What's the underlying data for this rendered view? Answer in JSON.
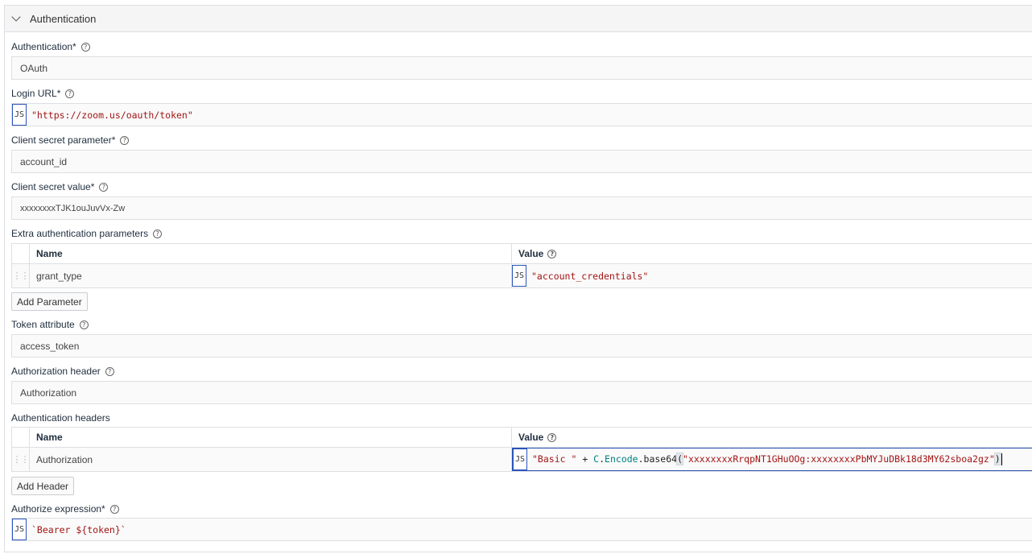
{
  "section": {
    "title": "Authentication"
  },
  "help_glyph": "?",
  "js_badge": "JS",
  "authentication": {
    "label": "Authentication*",
    "value": "OAuth"
  },
  "login_url": {
    "label": "Login URL*",
    "value": "\"https://zoom.us/oauth/token\""
  },
  "client_secret_parameter": {
    "label": "Client secret parameter*",
    "value": "account_id"
  },
  "client_secret_value": {
    "label": "Client secret value*",
    "value": "xxxxxxxxTJK1ouJuvVx-Zw"
  },
  "extra_params": {
    "label": "Extra authentication parameters",
    "columns": {
      "name": "Name",
      "value": "Value"
    },
    "rows": [
      {
        "name": "grant_type",
        "value": "\"account_credentials\""
      }
    ],
    "add_button": "Add Parameter"
  },
  "token_attribute": {
    "label": "Token attribute",
    "value": "access_token"
  },
  "authorization_header": {
    "label": "Authorization header",
    "value": "Authorization"
  },
  "auth_headers": {
    "label": "Authentication headers",
    "columns": {
      "name": "Name",
      "value": "Value"
    },
    "rows": [
      {
        "name": "Authorization",
        "value_parts": {
          "str1": "\"Basic \"",
          "plus": " + ",
          "obj": "C",
          "dot": ".",
          "enc": "Encode",
          "dot2": ".",
          "fn": "base64",
          "open": "(",
          "str2": "\"xxxxxxxxRrqpNT1GHuOOg:xxxxxxxxPbMYJuDBk18d3MY62sboa2gz\"",
          "close": ")"
        }
      }
    ],
    "add_button": "Add Header"
  },
  "authorize_expression": {
    "label": "Authorize expression*",
    "value": "`Bearer ${token}`"
  },
  "colors": {
    "accent": "#2c54b8",
    "string": "#a31515",
    "border": "#dcdfe3"
  }
}
